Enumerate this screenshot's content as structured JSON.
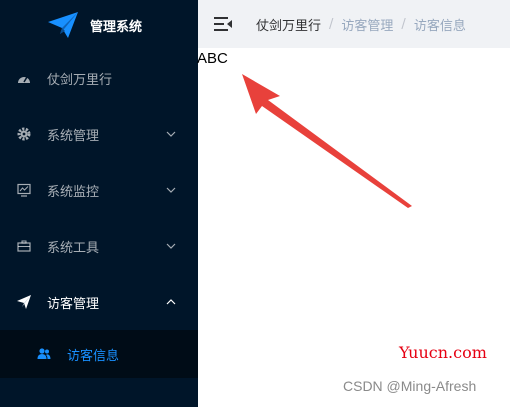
{
  "sidebar": {
    "title": "管理系统",
    "items": [
      {
        "label": "仗剑万里行",
        "icon": "dashboard-icon",
        "has_children": false
      },
      {
        "label": "系统管理",
        "icon": "gear-icon",
        "has_children": true,
        "expanded": false
      },
      {
        "label": "系统监控",
        "icon": "monitor-icon",
        "has_children": true,
        "expanded": false
      },
      {
        "label": "系统工具",
        "icon": "toolbox-icon",
        "has_children": true,
        "expanded": false
      },
      {
        "label": "访客管理",
        "icon": "send-icon",
        "has_children": true,
        "expanded": true
      }
    ],
    "submenu": [
      {
        "label": "访客信息",
        "icon": "users-icon",
        "active": true
      }
    ]
  },
  "header": {
    "menu_toggle_icon": "menu-fold-icon",
    "breadcrumb": [
      "仗剑万里行",
      "访客管理",
      "访客信息"
    ],
    "separator": "/"
  },
  "main": {
    "text": "ABC"
  },
  "annotation": {
    "arrow_color": "#e8413b"
  },
  "watermarks": {
    "site": "Yuucn.com",
    "author": "CSDN @Ming-Afresh"
  },
  "colors": {
    "sidebar_bg": "#001529",
    "submenu_bg": "#000c17",
    "active": "#1890ff",
    "header_bg": "#f0f2f5"
  }
}
